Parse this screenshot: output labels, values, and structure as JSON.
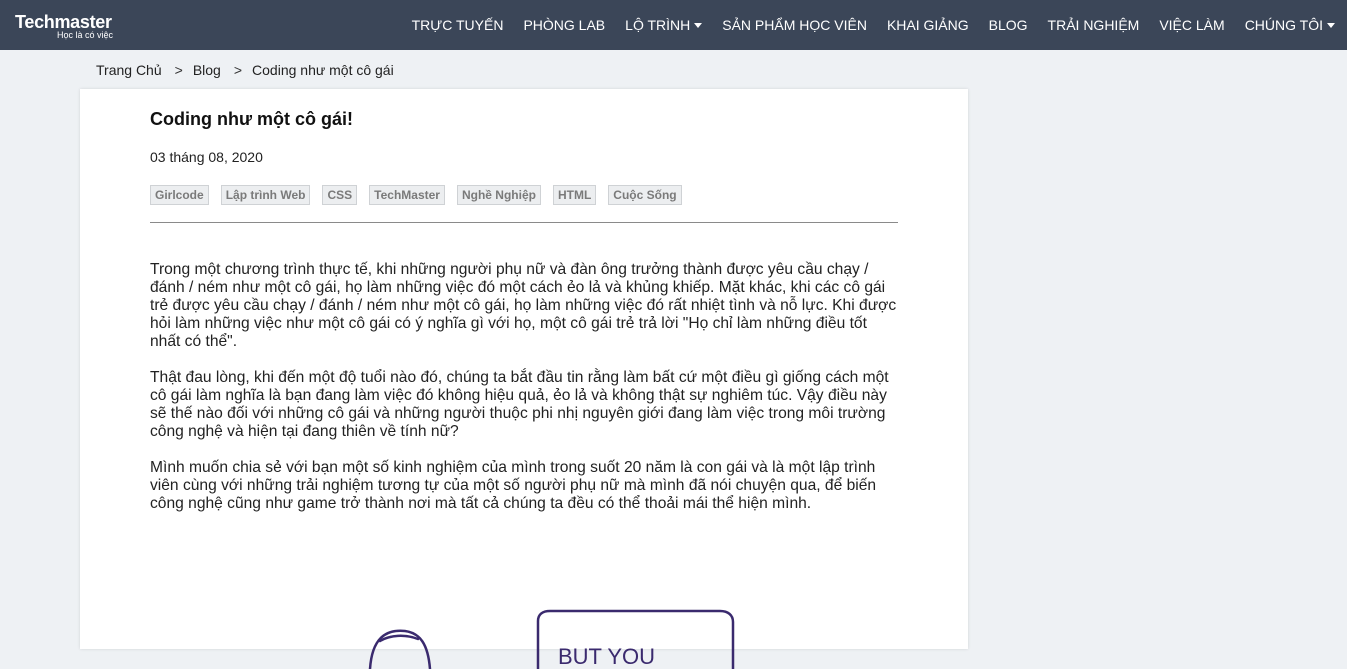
{
  "brand": {
    "name": "Techmaster",
    "tagline": "Học là có việc"
  },
  "nav": {
    "items": [
      {
        "label": "TRỰC TUYẾN",
        "dropdown": false
      },
      {
        "label": "PHÒNG LAB",
        "dropdown": false
      },
      {
        "label": "LỘ TRÌNH",
        "dropdown": true
      },
      {
        "label": "SẢN PHẨM HỌC VIÊN",
        "dropdown": false
      },
      {
        "label": "KHAI GIẢNG",
        "dropdown": false
      },
      {
        "label": "BLOG",
        "dropdown": false
      },
      {
        "label": "TRẢI NGHIỆM",
        "dropdown": false
      },
      {
        "label": "VIỆC LÀM",
        "dropdown": false
      },
      {
        "label": "CHÚNG TÔI",
        "dropdown": true
      }
    ]
  },
  "breadcrumb": {
    "items": [
      "Trang Chủ",
      "Blog",
      "Coding như một cô gái"
    ],
    "separator": ">"
  },
  "article": {
    "title": "Coding như một cô gái!",
    "date": "03 tháng 08, 2020",
    "tags": [
      "Girlcode",
      "Lập trình Web",
      "CSS",
      "TechMaster",
      "Nghề Nghiệp",
      "HTML",
      "Cuộc Sống"
    ],
    "paragraphs": [
      "Trong một chương trình thực tế, khi những người phụ nữ và đàn ông trưởng thành được yêu cầu chạy / đánh / ném như một cô gái, họ làm những việc đó một cách ẻo lả và khủng khiếp. Mặt khác, khi các cô gái trẻ được yêu cầu chạy / đánh / ném như một cô gái, họ làm những việc đó rất nhiệt tình và nỗ lực. Khi được hỏi làm những việc như một cô gái có ý nghĩa gì với họ, một cô gái trẻ trả lời \"Họ chỉ làm những điều tốt nhất có thể\".",
      "Thật đau lòng, khi đến một độ tuổi nào đó, chúng ta bắt đầu tin rằng làm bất cứ một điều gì giống cách một cô gái làm nghĩa là bạn đang làm việc đó không hiệu quả, ẻo lả và không thật sự nghiêm túc. Vậy điều này sẽ thế nào đối với những cô gái và những người thuộc phi nhị nguyên giới đang làm việc trong môi trường công nghệ và hiện tại đang thiên về tính nữ?",
      "Mình muốn chia sẻ với bạn một số kinh nghiệm của mình trong suốt 20 năm là con gái và là một lập trình viên cùng với những trải nghiệm tương tự của một số người phụ nữ mà mình đã nói chuyện qua, để biến công nghệ cũng như game trở thành nơi mà tất cả chúng ta đều có thể thoải mái thể hiện mình."
    ],
    "illustration_text": "BUT YOU"
  },
  "colors": {
    "navbar": "#3b4658",
    "page_bg": "#eef1f4",
    "tag_bg": "#eceef0",
    "ink": "#3a2a6e"
  }
}
